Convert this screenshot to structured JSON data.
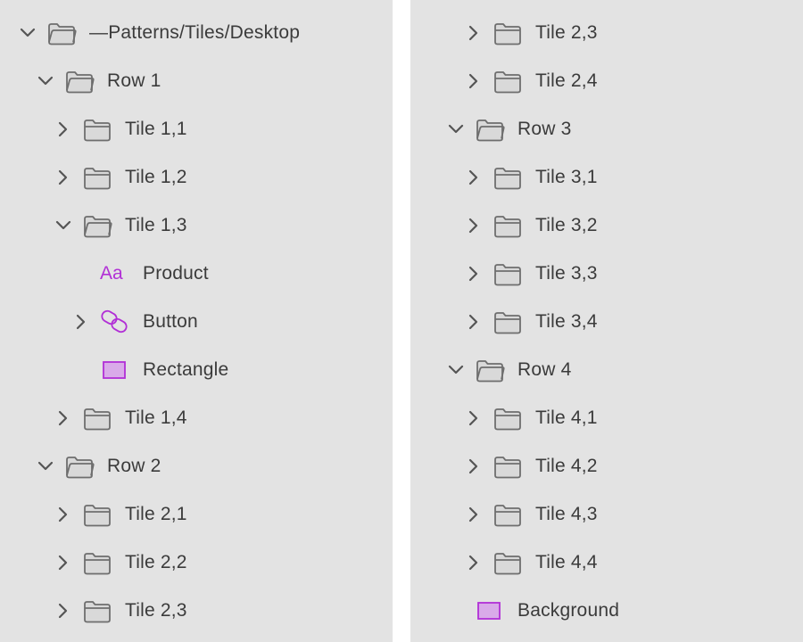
{
  "layers_left": [
    {
      "label": "—Patterns/Tiles/Desktop",
      "level": 0,
      "chevron": "down",
      "icon": "folder-open-icon"
    },
    {
      "label": "Row 1",
      "level": 1,
      "chevron": "down",
      "icon": "folder-open-icon"
    },
    {
      "label": "Tile 1,1",
      "level": 2,
      "chevron": "right",
      "icon": "folder-icon"
    },
    {
      "label": "Tile 1,2",
      "level": 2,
      "chevron": "right",
      "icon": "folder-icon"
    },
    {
      "label": "Tile 1,3",
      "level": 2,
      "chevron": "down",
      "icon": "folder-open-icon"
    },
    {
      "label": "Product",
      "level": 3,
      "chevron": "none",
      "icon": "text-icon",
      "icon_text": "Aa"
    },
    {
      "label": "Button",
      "level": 3,
      "chevron": "right",
      "icon": "symbol-link-icon"
    },
    {
      "label": "Rectangle",
      "level": 3,
      "chevron": "none",
      "icon": "rectangle-icon"
    },
    {
      "label": "Tile 1,4",
      "level": 2,
      "chevron": "right",
      "icon": "folder-icon"
    },
    {
      "label": "Row 2",
      "level": 1,
      "chevron": "down",
      "icon": "folder-open-icon"
    },
    {
      "label": "Tile 2,1",
      "level": 2,
      "chevron": "right",
      "icon": "folder-icon"
    },
    {
      "label": "Tile 2,2",
      "level": 2,
      "chevron": "right",
      "icon": "folder-icon"
    },
    {
      "label": "Tile 2,3",
      "level": 2,
      "chevron": "right",
      "icon": "folder-icon"
    }
  ],
  "layers_right": [
    {
      "label": "Tile 2,3",
      "level": 2,
      "chevron": "right",
      "icon": "folder-icon"
    },
    {
      "label": "Tile 2,4",
      "level": 2,
      "chevron": "right",
      "icon": "folder-icon"
    },
    {
      "label": "Row 3",
      "level": 1,
      "chevron": "down",
      "icon": "folder-open-icon"
    },
    {
      "label": "Tile 3,1",
      "level": 2,
      "chevron": "right",
      "icon": "folder-icon"
    },
    {
      "label": "Tile 3,2",
      "level": 2,
      "chevron": "right",
      "icon": "folder-icon"
    },
    {
      "label": "Tile 3,3",
      "level": 2,
      "chevron": "right",
      "icon": "folder-icon"
    },
    {
      "label": "Tile 3,4",
      "level": 2,
      "chevron": "right",
      "icon": "folder-icon"
    },
    {
      "label": "Row 4",
      "level": 1,
      "chevron": "down",
      "icon": "folder-open-icon"
    },
    {
      "label": "Tile 4,1",
      "level": 2,
      "chevron": "right",
      "icon": "folder-icon"
    },
    {
      "label": "Tile 4,2",
      "level": 2,
      "chevron": "right",
      "icon": "folder-icon"
    },
    {
      "label": "Tile 4,3",
      "level": 2,
      "chevron": "right",
      "icon": "folder-icon"
    },
    {
      "label": "Tile 4,4",
      "level": 2,
      "chevron": "right",
      "icon": "folder-icon"
    },
    {
      "label": "Background",
      "level": 1,
      "chevron": "none",
      "icon": "rectangle-icon"
    }
  ],
  "colors": {
    "panel_bg": "#e3e3e3",
    "text": "#3b3b3b",
    "folder_stroke": "#6e6e6e",
    "folder_fill": "#d9d9d9",
    "symbol_purple": "#b12fd6",
    "rectangle_fill": "#d9aae9"
  }
}
